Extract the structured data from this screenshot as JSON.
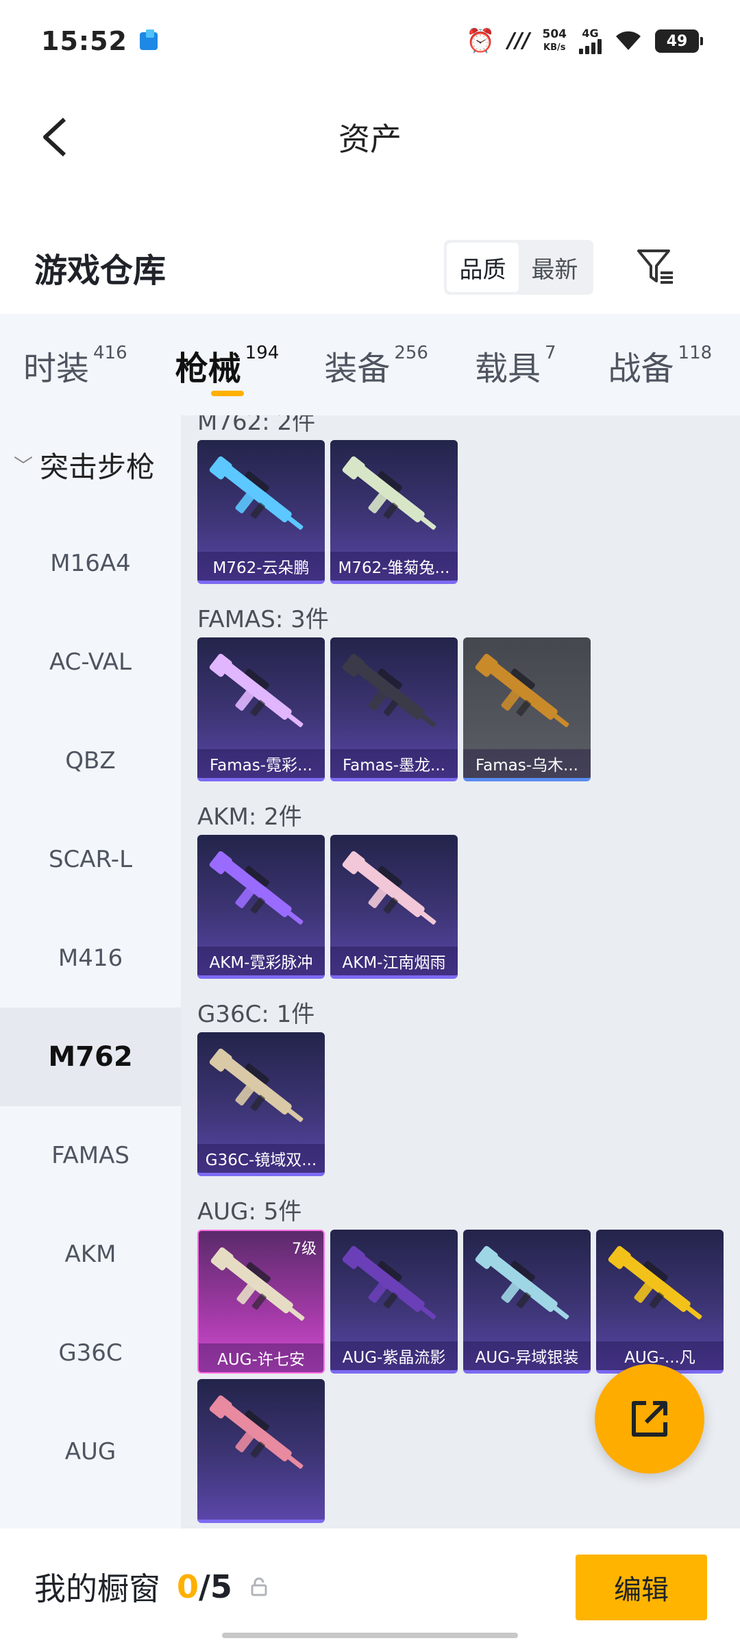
{
  "status_bar": {
    "time": "15:52",
    "speed_value": "504",
    "speed_unit": "KB/s",
    "network": "4G",
    "battery": "49",
    "icons": [
      "alarm-icon",
      "signal-icon",
      "wifi-icon",
      "battery-icon"
    ]
  },
  "header": {
    "title": "资产"
  },
  "section": {
    "title": "游戏仓库",
    "sort_options": [
      "品质",
      "最新"
    ],
    "active_sort": "品质"
  },
  "tabs": [
    {
      "label": "时装",
      "count": "416"
    },
    {
      "label": "枪械",
      "count": "194",
      "active": true
    },
    {
      "label": "装备",
      "count": "256"
    },
    {
      "label": "载具",
      "count": "7"
    },
    {
      "label": "战备",
      "count": "118"
    }
  ],
  "sidebar": {
    "group_label": "突击步枪",
    "items": [
      "M16A4",
      "AC-VAL",
      "QBZ",
      "SCAR-L",
      "M416",
      "M762",
      "FAMAS",
      "AKM",
      "G36C",
      "AUG"
    ],
    "active_item": "M762"
  },
  "groups": [
    {
      "title": "M762: 2件",
      "items": [
        {
          "name": "M762-云朵鹏",
          "style": "purple",
          "gun_color": "#5cc8ff"
        },
        {
          "name": "M762-雏菊兔...",
          "style": "purple",
          "gun_color": "#d8e6c8"
        }
      ]
    },
    {
      "title": "FAMAS: 3件",
      "items": [
        {
          "name": "Famas-霓彩...",
          "style": "purple",
          "gun_color": "#e0b6ff"
        },
        {
          "name": "Famas-墨龙...",
          "style": "purple",
          "gun_color": "#3a3a48"
        },
        {
          "name": "Famas-乌木...",
          "style": "grey",
          "gun_color": "#c98a2a"
        }
      ]
    },
    {
      "title": "AKM: 2件",
      "items": [
        {
          "name": "AKM-霓彩脉冲",
          "style": "purple",
          "gun_color": "#9a6bff"
        },
        {
          "name": "AKM-江南烟雨",
          "style": "purple",
          "gun_color": "#f2c8d8"
        }
      ]
    },
    {
      "title": "G36C: 1件",
      "items": [
        {
          "name": "G36C-镜域双...",
          "style": "purple",
          "gun_color": "#d9c9a6"
        }
      ]
    },
    {
      "title": "AUG: 5件",
      "items": [
        {
          "name": "AUG-许七安",
          "style": "pink",
          "level": "7级",
          "gun_color": "#e6dcc4"
        },
        {
          "name": "AUG-紫晶流影",
          "style": "purple",
          "gun_color": "#6b3fb8"
        },
        {
          "name": "AUG-异域银装",
          "style": "purple",
          "gun_color": "#9fd6e6"
        },
        {
          "name": "AUG-...凡",
          "style": "purple",
          "gun_color": "#f2c21a"
        },
        {
          "name": "",
          "style": "purple",
          "gun_color": "#e88aa0"
        }
      ]
    }
  ],
  "showcase": {
    "title": "我的橱窗",
    "current": "0",
    "separator": "/",
    "max": "5",
    "edit_label": "编辑"
  },
  "colors": {
    "accent": "#ffb000",
    "card_purple": "#3d3575",
    "card_pink": "#d44dd4"
  }
}
